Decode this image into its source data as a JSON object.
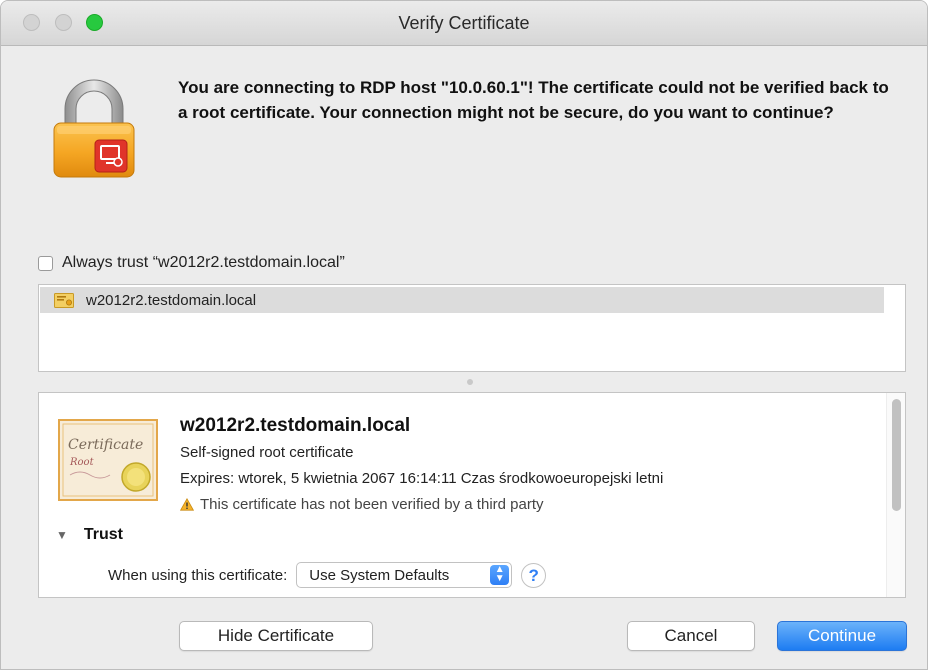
{
  "window": {
    "title": "Verify Certificate"
  },
  "message": "You are connecting to RDP host \"10.0.60.1\"! The certificate could not be verified back to a root certificate. Your connection might not be secure, do you want to continue?",
  "always_trust": {
    "label": "Always trust “w2012r2.testdomain.local”",
    "checked": false
  },
  "cert_list": {
    "items": [
      {
        "label": "w2012r2.testdomain.local",
        "selected": true
      }
    ]
  },
  "details": {
    "name": "w2012r2.testdomain.local",
    "type": "Self-signed root certificate",
    "expires": "Expires: wtorek, 5 kwietnia 2067 16:14:11 Czas środkowoeuropejski letni",
    "warning": "This certificate has not been verified by a third party",
    "trust_label": "Trust",
    "when_using_label": "When using this certificate:",
    "policy_value": "Use System Defaults",
    "help_label": "?"
  },
  "cert_image_text": {
    "line1": "Certificate",
    "line2": "Root"
  },
  "buttons": {
    "hide_certificate": "Hide Certificate",
    "cancel": "Cancel",
    "continue": "Continue"
  },
  "colors": {
    "accent": "#1d7cf2",
    "lock_gold": "#f2a81d",
    "lock_badge_red": "#e0342a",
    "window_bg": "#ececec"
  },
  "icons": {
    "lock": "padlock-rdp-icon",
    "cert_small": "certificate-small-icon",
    "cert_large": "certificate-icon",
    "warning": "warning-triangle-icon",
    "help": "help-icon"
  }
}
